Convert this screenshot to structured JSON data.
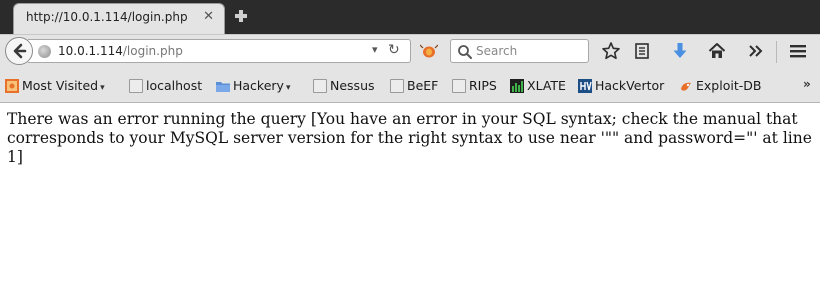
{
  "tab": {
    "title": "http://10.0.1.114/login.php",
    "close_icon": "close-icon"
  },
  "urlbar": {
    "host": "10.0.1.114",
    "path": "/login.php"
  },
  "search": {
    "placeholder": "Search"
  },
  "bookmarks": [
    {
      "label": "Most Visited",
      "icon": "most-visited-icon",
      "has_dropdown": true
    },
    {
      "label": "localhost",
      "icon": "page-icon"
    },
    {
      "label": "Hackery",
      "icon": "folder-icon",
      "has_dropdown": true
    },
    {
      "label": "Nessus",
      "icon": "page-icon"
    },
    {
      "label": "BeEF",
      "icon": "page-icon"
    },
    {
      "label": "RIPS",
      "icon": "page-icon"
    },
    {
      "label": "XLATE",
      "icon": "xlate-icon"
    },
    {
      "label": "HackVertor",
      "icon": "hackvertor-icon"
    },
    {
      "label": "Exploit-DB",
      "icon": "exploit-db-icon"
    }
  ],
  "overflow_label": "»",
  "page": {
    "message": "There was an error running the query [You have an error in your SQL syntax; check the manual that corresponds to your MySQL server version for the right syntax to use near '\"\" and password=\"' at line 1]"
  },
  "colors": {
    "tabstrip": "#2b2b2b",
    "toolbar": "#e4e4e4",
    "download_arrow": "#4a90e2",
    "folder": "#5a8fd6"
  }
}
